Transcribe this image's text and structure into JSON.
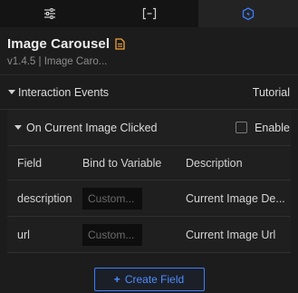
{
  "tabs": [
    {
      "icon": "sliders-icon",
      "active": false
    },
    {
      "icon": "bracket-minus-icon",
      "active": false
    },
    {
      "icon": "event-bolt-icon",
      "active": true
    }
  ],
  "header": {
    "title": "Image Carousel",
    "title_icon": "document-icon",
    "subtitle": "v1.4.5 | Image Caro..."
  },
  "interaction": {
    "section_label": "Interaction Events",
    "tutorial_label": "Tutorial",
    "event": {
      "label": "On Current Image Clicked",
      "enable_label": "Enable",
      "enabled": false
    },
    "table": {
      "headers": [
        "Field",
        "Bind to Variable",
        "Description"
      ],
      "rows": [
        {
          "field": "description",
          "variable_placeholder": "Custom...",
          "description": "Current Image De..."
        },
        {
          "field": "url",
          "variable_placeholder": "Custom...",
          "description": "Current Image Url"
        }
      ]
    },
    "create_button": {
      "plus": "+",
      "label": "Create Field"
    }
  },
  "colors": {
    "background": "#1c1c1c",
    "accent_blue": "#3d7eff",
    "title_icon_orange": "#f0a23a"
  }
}
